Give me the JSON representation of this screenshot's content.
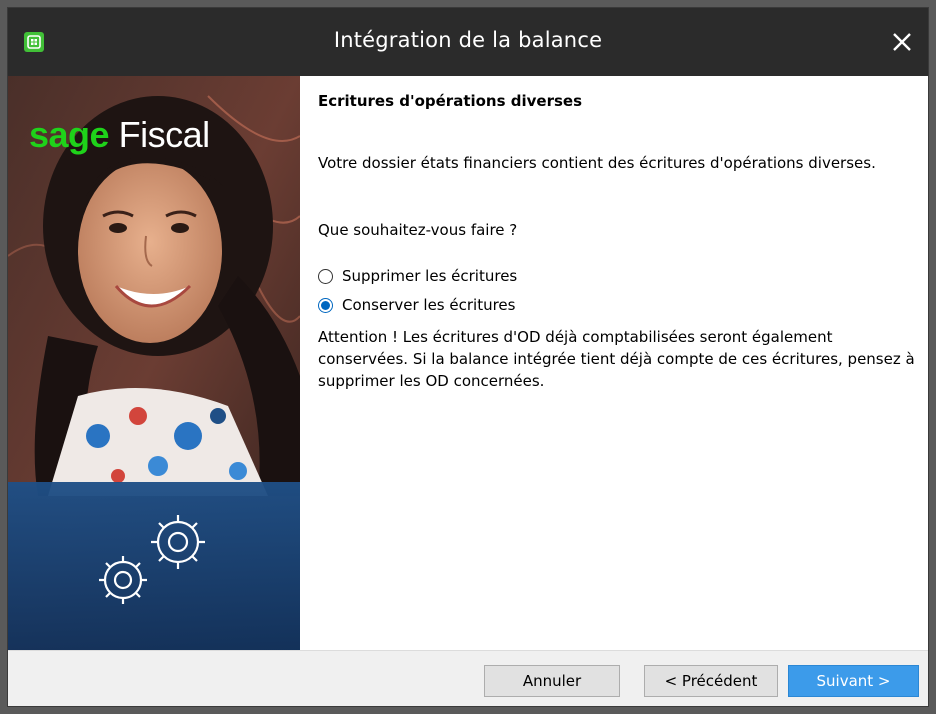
{
  "window": {
    "title": "Intégration de la balance"
  },
  "brand": {
    "sage": "sage",
    "product": "Fiscal"
  },
  "content": {
    "section_title": "Ecritures d'opérations diverses",
    "paragraph": "Votre dossier états financiers contient des écritures d'opérations diverses.",
    "question": "Que souhaitez-vous faire ?",
    "options": [
      {
        "label": "Supprimer les écritures",
        "selected": false
      },
      {
        "label": "Conserver les écritures",
        "selected": true
      }
    ],
    "warning": "Attention ! Les écritures d'OD déjà comptabilisées seront également conservées. Si la balance intégrée tient déjà compte de ces écritures, pensez à supprimer les OD concernées."
  },
  "footer": {
    "cancel_label": "Annuler",
    "previous_label": "< Précédent",
    "next_label": "Suivant >"
  },
  "icons": {
    "app": "sage-app-icon",
    "close": "close-icon",
    "gears": "gears-icon"
  },
  "colors": {
    "titlebar": "#2b2b2b",
    "brand_green": "#1fd21a",
    "accent_blue": "#3c9bea",
    "radio_blue": "#0067c0",
    "footer_bg": "#f0f0f0"
  }
}
